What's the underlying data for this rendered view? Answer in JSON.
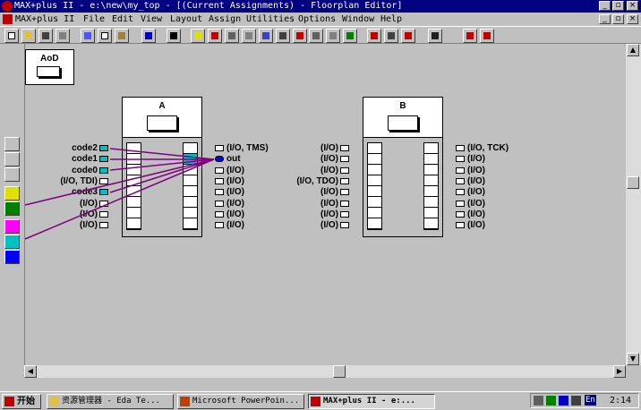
{
  "window": {
    "title": "MAX+plus II - e:\\new\\my_top - [(Current Assignments) - Floorplan Editor]"
  },
  "menu": {
    "app": "MAX+plus II",
    "items": [
      "File",
      "Edit",
      "View",
      "Layout",
      "Assign",
      "Utilities",
      "Options",
      "Window",
      "Help"
    ]
  },
  "aod": {
    "label": "AoD"
  },
  "chipA": {
    "label": "A",
    "left_pins": [
      "code2",
      "code1",
      "code0",
      "(I/O, TDI)",
      "code3",
      "(I/O)",
      "(I/O)",
      "(I/O)"
    ],
    "right_pins": [
      "(I/O, TMS)",
      "out",
      "(I/O)",
      "(I/O)",
      "(I/O)",
      "(I/O)",
      "(I/O)",
      "(I/O)"
    ]
  },
  "chipB": {
    "label": "B",
    "left_pins": [
      "(I/O)",
      "(I/O)",
      "(I/O)",
      "(I/O, TDO)",
      "(I/O)",
      "(I/O)",
      "(I/O)",
      "(I/O)"
    ],
    "right_pins": [
      "(I/O, TCK)",
      "(I/O)",
      "(I/O)",
      "(I/O)",
      "(I/O)",
      "(I/O)",
      "(I/O)",
      "(I/O)"
    ]
  },
  "taskbar": {
    "start": "开始",
    "tasks": [
      "资源管理器 - Eda Te...",
      "Microsoft PowerPoin...",
      "MAX+plus II - e:..."
    ],
    "lang": "En",
    "clock": "2:14"
  },
  "colors": {
    "title_bg": "#000080",
    "wire": "#800080",
    "pin_assigned": "#00c0c0",
    "pin_out": "#0000ff"
  }
}
